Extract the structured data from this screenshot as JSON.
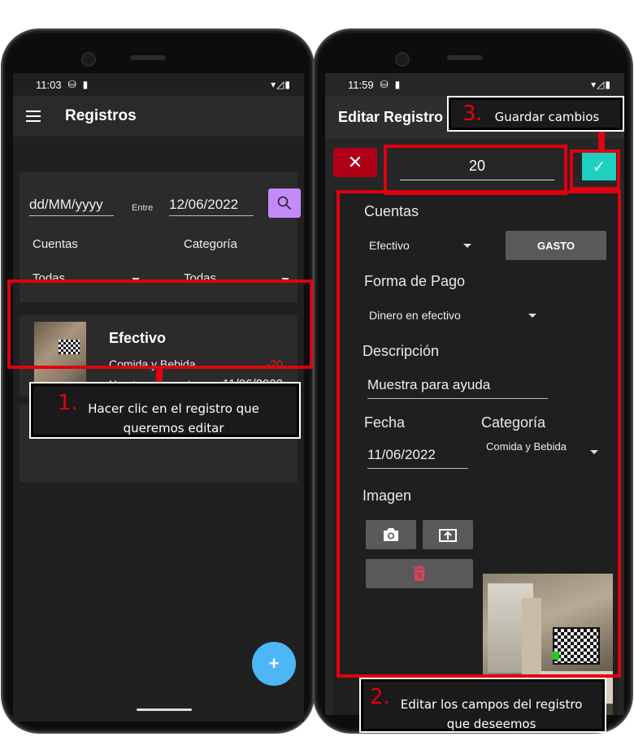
{
  "left": {
    "status": {
      "time": "11:03"
    },
    "appbar": {
      "title": "Registros"
    },
    "filter": {
      "date_from_placeholder": "dd/MM/yyyy",
      "between_label": "Entre",
      "date_to": "12/06/2022",
      "cuentas_label": "Cuentas",
      "cuentas_value": "Todas",
      "categoria_label": "Categoría",
      "categoria_value": "Todas"
    },
    "record": {
      "title": "Efectivo",
      "category": "Comida y Bebida",
      "amount": "-20",
      "description": "Muestra para ayuda",
      "date": "11/06/2022"
    },
    "callout": {
      "number": "1.",
      "text": "Hacer clic en el registro que queremos editar"
    },
    "fab_label": "+"
  },
  "right": {
    "status": {
      "time": "11:59"
    },
    "appbar": {
      "title": "Editar Registro"
    },
    "amount": "20",
    "cuentas": {
      "label": "Cuentas",
      "value": "Efectivo",
      "type_button": "GASTO"
    },
    "forma_pago": {
      "label": "Forma de Pago",
      "value": "Dinero en efectivo"
    },
    "descripcion": {
      "label": "Descripción",
      "value": "Muestra para ayuda"
    },
    "fecha": {
      "label": "Fecha",
      "value": "11/06/2022"
    },
    "categoria": {
      "label": "Categoría",
      "value": "Comida y Bebida"
    },
    "imagen": {
      "label": "Imagen"
    },
    "callout_save": {
      "number": "3.",
      "text": "Guardar cambios"
    },
    "callout_edit": {
      "number": "2.",
      "text": "Editar los campos del registro que deseemos"
    }
  },
  "colors": {
    "annotation_red": "#e0000f",
    "fab_blue": "#4db6f7",
    "search_purple": "#c58af9",
    "confirm_teal": "#1ed0c0",
    "cancel_red": "#b00018",
    "negative_amount": "#e02020"
  }
}
